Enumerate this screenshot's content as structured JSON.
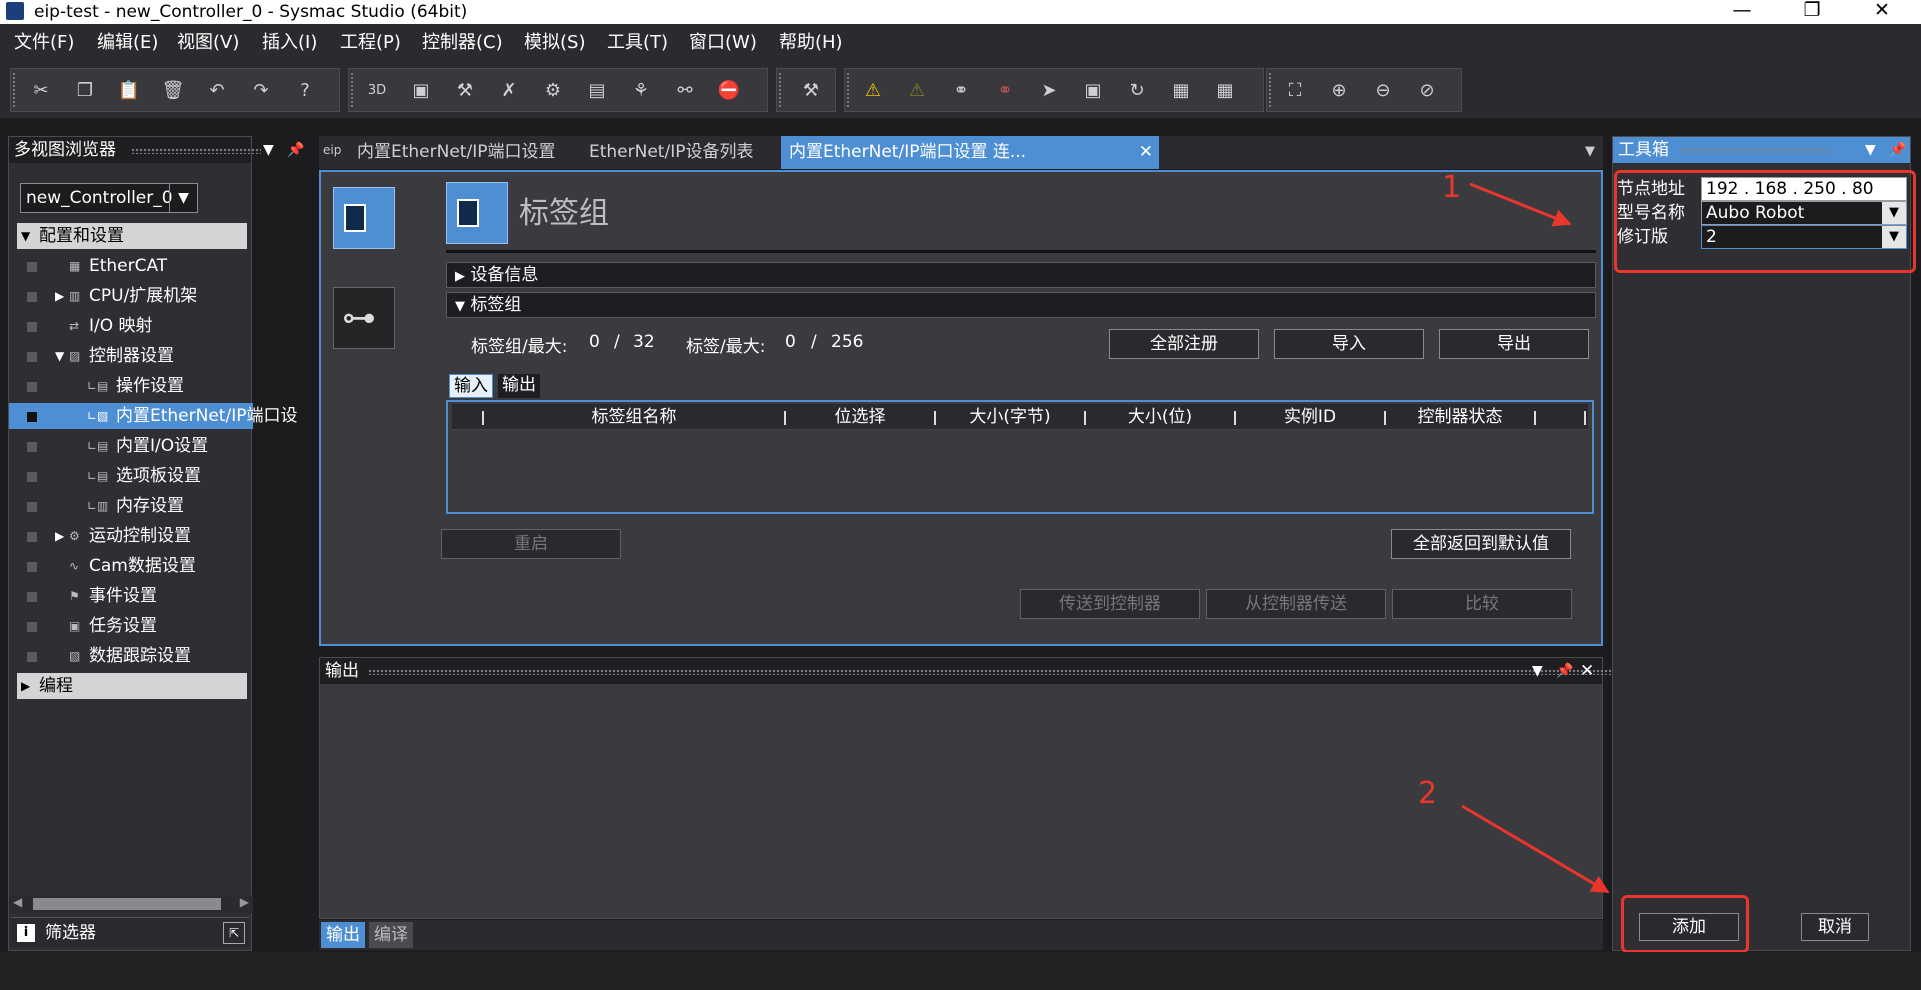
{
  "window": {
    "title": "eip-test - new_Controller_0 - Sysmac Studio (64bit)",
    "minimize": "—",
    "restore": "❐",
    "close": "✕"
  },
  "menu": [
    "文件(F)",
    "编辑(E)",
    "视图(V)",
    "插入(I)",
    "工程(P)",
    "控制器(C)",
    "模拟(S)",
    "工具(T)",
    "窗口(W)",
    "帮助(H)"
  ],
  "toolbar": {
    "group1": [
      {
        "icon": "cut-icon",
        "glyph": "✂"
      },
      {
        "icon": "copy-icon",
        "glyph": "❐"
      },
      {
        "icon": "paste-icon",
        "glyph": "📋"
      },
      {
        "icon": "delete-icon",
        "glyph": "🗑"
      },
      {
        "icon": "undo-icon",
        "glyph": "↶"
      },
      {
        "icon": "redo-icon",
        "glyph": "↷"
      },
      {
        "icon": "help-icon",
        "glyph": "?"
      }
    ],
    "group2": [
      {
        "icon": "3d-icon",
        "glyph": "3D"
      },
      {
        "icon": "window-icon",
        "glyph": "▣"
      },
      {
        "icon": "build-icon",
        "glyph": "⚒"
      },
      {
        "icon": "rebuild-icon",
        "glyph": "✗"
      },
      {
        "icon": "check-icon",
        "glyph": "⚙"
      },
      {
        "icon": "table-icon",
        "glyph": "▤"
      },
      {
        "icon": "network-icon",
        "glyph": "⚘"
      },
      {
        "icon": "binoculars-icon",
        "glyph": "⚯"
      },
      {
        "icon": "alert-icon",
        "glyph": "⛔"
      }
    ],
    "group3": [
      {
        "icon": "tool-icon",
        "glyph": "⚒"
      }
    ],
    "group4": [
      {
        "icon": "warning-icon",
        "glyph": "⚠"
      },
      {
        "icon": "warning-off-icon",
        "glyph": "⚠"
      },
      {
        "icon": "online-icon",
        "glyph": "⚭"
      },
      {
        "icon": "offline-icon",
        "glyph": "⚭"
      },
      {
        "icon": "transfer-icon",
        "glyph": "➤"
      },
      {
        "icon": "sync-icon",
        "glyph": "▣"
      },
      {
        "icon": "reset-icon",
        "glyph": "↻"
      },
      {
        "icon": "monitor-icon",
        "glyph": "▦"
      },
      {
        "icon": "monitor2-icon",
        "glyph": "▦"
      }
    ],
    "group5": [
      {
        "icon": "fit-icon",
        "glyph": "⛶"
      },
      {
        "icon": "zoom-in-icon",
        "glyph": "⊕"
      },
      {
        "icon": "zoom-out-icon",
        "glyph": "⊖"
      },
      {
        "icon": "zoom-reset-icon",
        "glyph": "⊘"
      }
    ]
  },
  "left_panel": {
    "title": "多视图浏览器",
    "controller": "new_Controller_0",
    "tree": [
      {
        "label": "配置和设置",
        "type": "category",
        "expanded": true
      },
      {
        "label": "EtherCAT",
        "indent": 1
      },
      {
        "label": "CPU/扩展机架",
        "indent": 1,
        "collapsed": true
      },
      {
        "label": "I/O 映射",
        "indent": 1
      },
      {
        "label": "控制器设置",
        "indent": 1,
        "expanded": true
      },
      {
        "label": "操作设置",
        "indent": 2
      },
      {
        "label": "内置EtherNet/IP端口设",
        "indent": 2,
        "selected": true
      },
      {
        "label": "内置I/O设置",
        "indent": 2
      },
      {
        "label": "选项板设置",
        "indent": 2
      },
      {
        "label": "内存设置",
        "indent": 2
      },
      {
        "label": "运动控制设置",
        "indent": 1,
        "collapsed": true
      },
      {
        "label": "Cam数据设置",
        "indent": 1
      },
      {
        "label": "事件设置",
        "indent": 1
      },
      {
        "label": "任务设置",
        "indent": 1
      },
      {
        "label": "数据跟踪设置",
        "indent": 1
      },
      {
        "label": "编程",
        "type": "category",
        "expanded": false
      }
    ],
    "filter": "筛选器"
  },
  "tabs": [
    {
      "label": "内置EtherNet/IP端口设置"
    },
    {
      "label": "EtherNet/IP设备列表"
    },
    {
      "label": "内置EtherNet/IP端口设置 连...",
      "active": true
    }
  ],
  "editor": {
    "heading": "标签组",
    "device_info": "设备信息",
    "tag_group_section": "标签组",
    "tag_group_max_label": "标签组/最大:",
    "tag_group_count": "0",
    "tag_group_max": "32",
    "tag_max_label": "标签/最大:",
    "tag_count": "0",
    "tag_max": "256",
    "slash": "/",
    "register_all": "全部注册",
    "import": "导入",
    "export": "导出",
    "io_tabs": [
      "输入",
      "输出"
    ],
    "columns": [
      "标签组名称",
      "位选择",
      "大小(字节)",
      "大小(位)",
      "实例ID",
      "控制器状态"
    ],
    "restart": "重启",
    "reset_default": "全部返回到默认值",
    "transfer_to": "传送到控制器",
    "transfer_from": "从控制器传送",
    "compare": "比较"
  },
  "output_panel": {
    "title": "输出",
    "tabs": [
      "输出",
      "编译"
    ]
  },
  "toolbox": {
    "title": "工具箱",
    "node_address_label": "节点地址",
    "node_address": "192 . 168 . 250 . 80",
    "model_label": "型号名称",
    "model": "Aubo Robot",
    "revision_label": "修订版",
    "revision": "2",
    "add": "添加",
    "cancel": "取消"
  },
  "annotations": {
    "step1": "1",
    "step2": "2",
    "color": "#e8362c"
  },
  "colors": {
    "accent": "#4e8fd4",
    "background": "#2e2e33"
  }
}
